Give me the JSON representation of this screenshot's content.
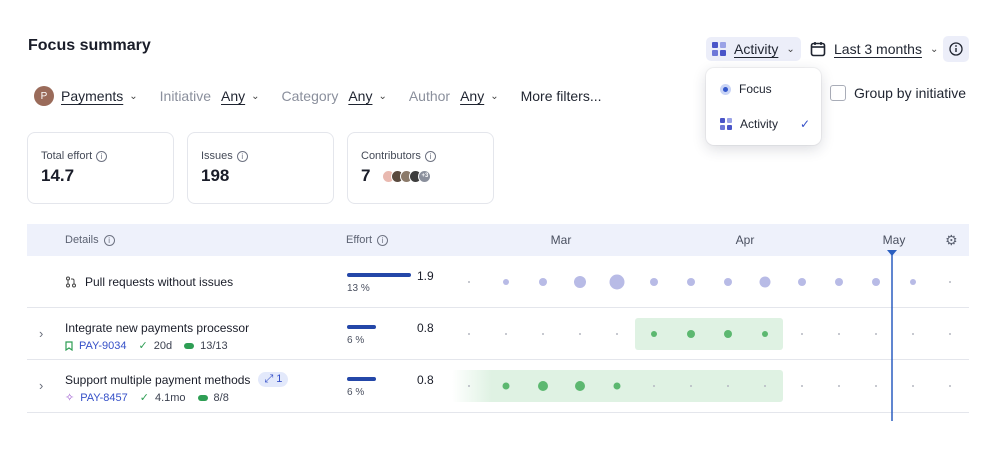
{
  "page": {
    "title": "Focus summary"
  },
  "controls": {
    "view_label": "Activity",
    "range_label": "Last 3 months",
    "group_by_label": "Group by initiative"
  },
  "view_menu": {
    "items": [
      {
        "label": "Focus",
        "selected": false
      },
      {
        "label": "Activity",
        "selected": true
      }
    ],
    "check_glyph": "✓"
  },
  "filters": {
    "team_initial": "P",
    "team": "Payments",
    "initiative_label": "Initiative",
    "initiative_value": "Any",
    "category_label": "Category",
    "category_value": "Any",
    "author_label": "Author",
    "author_value": "Any",
    "more": "More filters..."
  },
  "stats": {
    "total_effort_label": "Total effort",
    "total_effort_value": "14.7",
    "issues_label": "Issues",
    "issues_value": "198",
    "contributors_label": "Contributors",
    "contributors_value": "7",
    "contributors_more": "+3"
  },
  "table": {
    "details_header": "Details",
    "effort_header": "Effort",
    "months": [
      "Mar",
      "Apr",
      "May"
    ],
    "rows": [
      {
        "title": "Pull requests without issues",
        "effort": "1.9",
        "pct": "13 %",
        "share": 0.13
      },
      {
        "title": "Integrate new payments processor",
        "key": "PAY-9034",
        "duration": "20d",
        "progress": "13/13",
        "effort": "0.8",
        "pct": "6 %",
        "share": 0.06
      },
      {
        "title": "Support multiple payment methods",
        "badge": "1",
        "key": "PAY-8457",
        "duration": "4.1mo",
        "progress": "8/8",
        "effort": "0.8",
        "pct": "6 %",
        "share": 0.06
      }
    ]
  },
  "colors": {
    "accent": "#3550c8",
    "effort_bar": "#2447a8",
    "activity_fill": "#dff2e3",
    "activity_dot": "#5cb870",
    "pr_dot": "#b8bbe6",
    "today_line": "#2b5fc0"
  }
}
